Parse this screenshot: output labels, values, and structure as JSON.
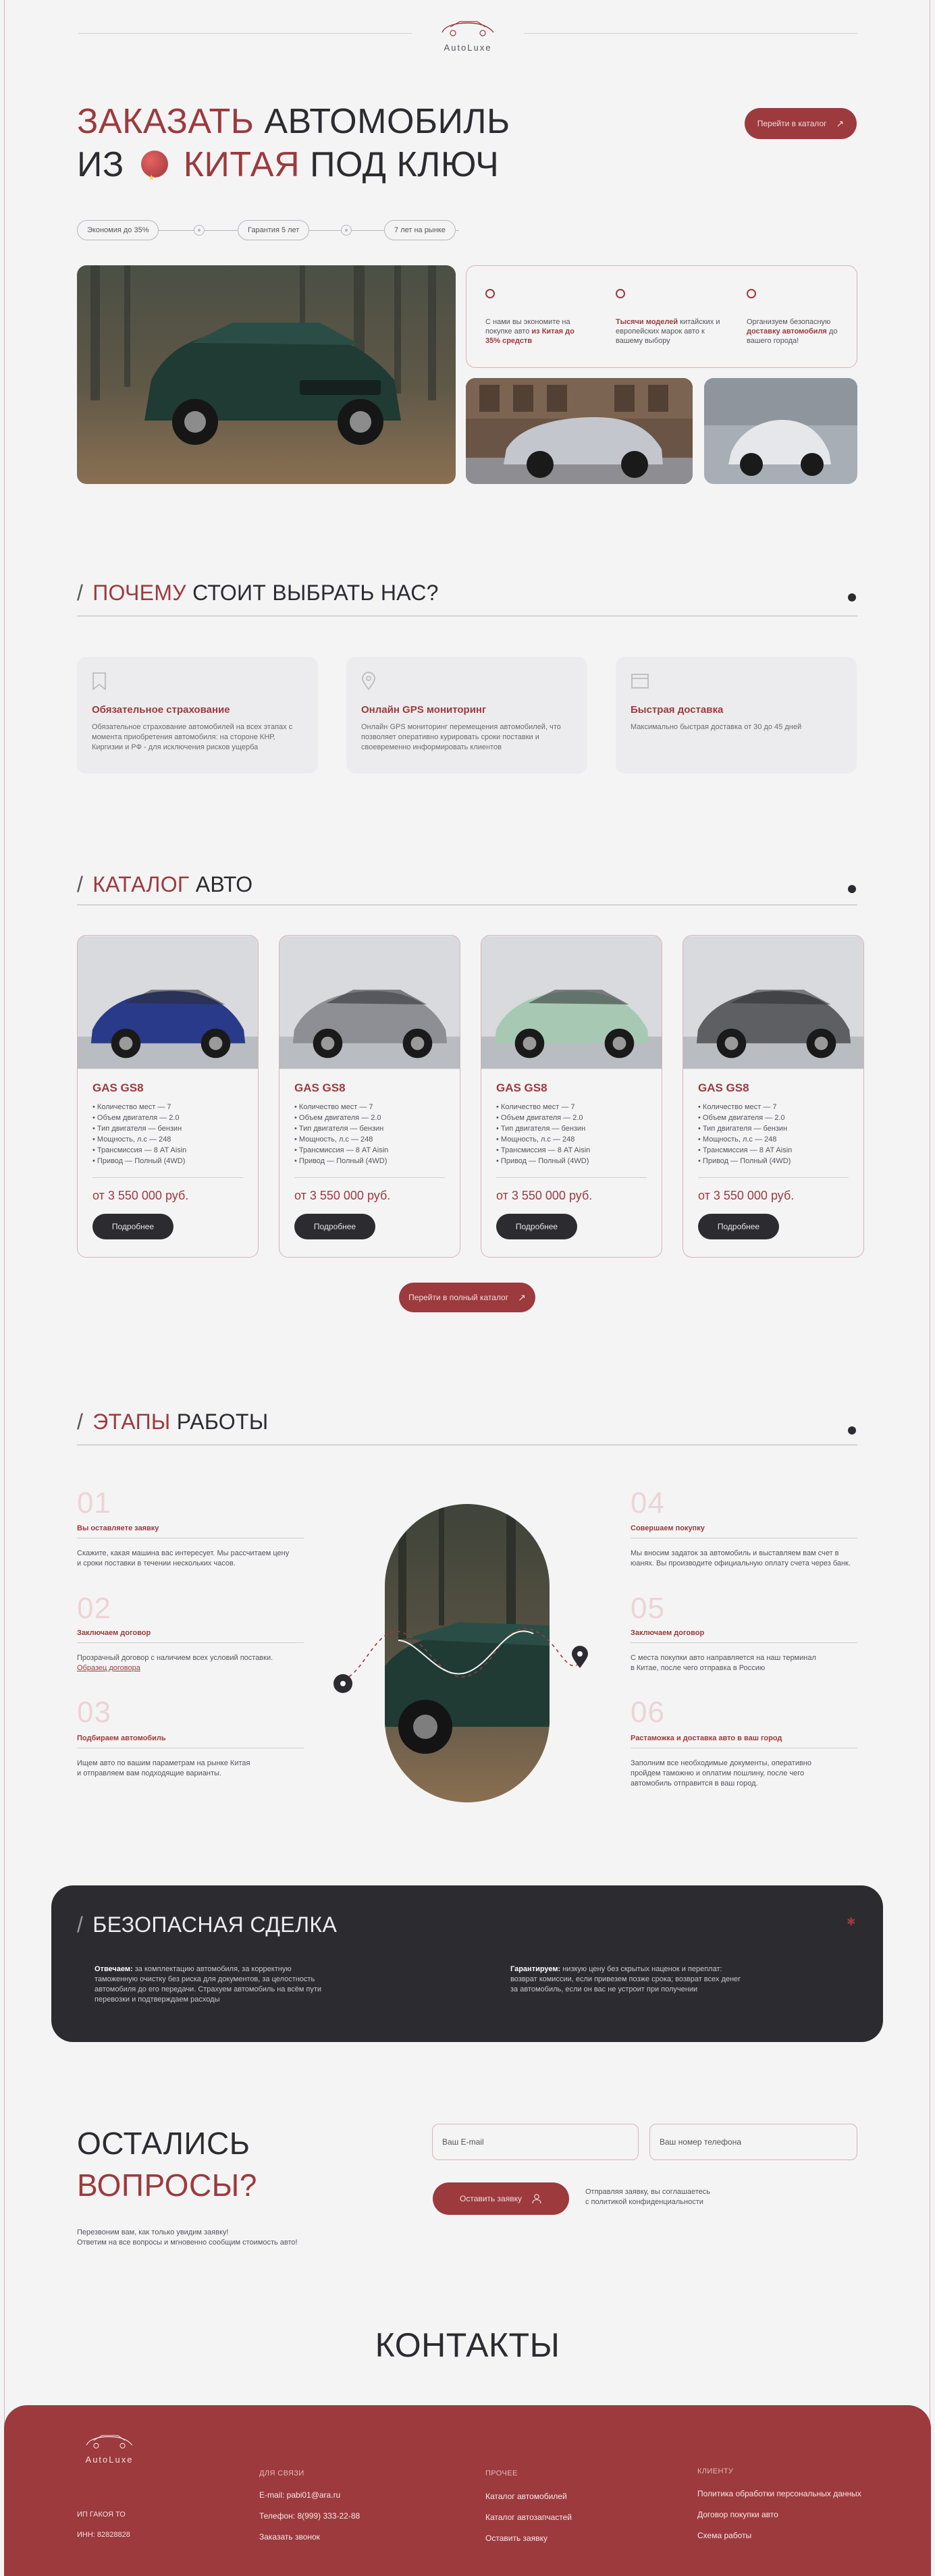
{
  "brand": {
    "name": "AutoLuxe"
  },
  "hero": {
    "title_line1_accent": "ЗАКАЗАТЬ",
    "title_line1_rest": "АВТОМОБИЛЬ",
    "title_line2_prefix": "ИЗ",
    "title_line2_accent": "КИТАЯ",
    "title_line2_rest": "ПОД КЛЮЧ",
    "catalog_button": "Перейти в каталог",
    "chips": [
      "Экономия до 35%",
      "Гарантия 5 лет",
      "7 лет на рынке"
    ],
    "benefits": [
      {
        "text": "С нами вы экономите на покупке авто",
        "bold": "из Китая до 35% средств"
      },
      {
        "bold": "Тысячи моделей",
        "text": "китайских и европейских марок авто к вашему выбору"
      },
      {
        "text": "Организуем безопасную",
        "bold": "доставку автомобиля",
        "text2": "до вашего города!"
      }
    ]
  },
  "why": {
    "title_accent": "ПОЧЕМУ",
    "title_rest": "СТОИТ ВЫБРАТЬ НАС?",
    "features": [
      {
        "icon": "bookmark-icon",
        "title": "Обязательное страхование",
        "text": "Обязательное страхование автомобилей на всех этапах с момента приобретения автомобиля: на стороне КНР, Киргизии и РФ - для исключения рисков ущерба"
      },
      {
        "icon": "map-pin-icon",
        "title": "Онлайн GPS мониторинг",
        "text": "Онлайн GPS мониторинг перемещения автомобилей, что позволяет оперативно курировать сроки поставки и своевременно информировать клиентов"
      },
      {
        "icon": "document-icon",
        "title": "Быстрая доставка",
        "text": "Максимально быстрая доставка от 30 до 45 дней"
      }
    ]
  },
  "catalog": {
    "title_accent": "КАТАЛОГ",
    "title_rest": "АВТО",
    "cars": [
      {
        "model": "GAS GS8",
        "specs": [
          "Количество мест — 7",
          "Объем двигателя — 2.0",
          "Тип двигателя — бензин",
          "Мощность, л.с — 248",
          "Трансмиссия — 8 AT Aisin",
          "Привод — Полный (4WD)"
        ],
        "price": "от 3 550 000 руб.",
        "button": "Подробнее",
        "color": "#2a3a8a"
      },
      {
        "model": "GAS GS8",
        "specs": [
          "Количество мест — 7",
          "Объем двигателя — 2.0",
          "Тип двигателя — бензин",
          "Мощность, л.с — 248",
          "Трансмиссия — 8 AT Aisin",
          "Привод — Полный (4WD)"
        ],
        "price": "от 3 550 000 руб.",
        "button": "Подробнее",
        "color": "#8d8f95"
      },
      {
        "model": "GAS GS8",
        "specs": [
          "Количество мест — 7",
          "Объем двигателя — 2.0",
          "Тип двигателя — бензин",
          "Мощность, л.с — 248",
          "Трансмиссия — 8 AT Aisin",
          "Привод — Полный (4WD)"
        ],
        "price": "от 3 550 000 руб.",
        "button": "Подробнее",
        "color": "#a7c9b4"
      },
      {
        "model": "GAS GS8",
        "specs": [
          "Количество мест — 7",
          "Объем двигателя — 2.0",
          "Тип двигателя — бензин",
          "Мощность, л.с — 248",
          "Трансмиссия — 8 AT Aisin",
          "Привод — Полный (4WD)"
        ],
        "price": "от 3 550 000 руб.",
        "button": "Подробнее",
        "color": "#5d5f63"
      }
    ],
    "full_catalog_button": "Перейти в полный каталог"
  },
  "steps": {
    "title_accent": "ЭТАПЫ",
    "title_rest": "РАБОТЫ",
    "items": [
      {
        "num": "01",
        "title": "Вы оставляете заявку",
        "text1": "Скажите, какая машина вас интересует. Мы рассчитаем цену",
        "text2": "и сроки поставки в течении нескольких часов."
      },
      {
        "num": "02",
        "title": "Заключаем договор",
        "text1": "Прозрачный договор с наличием всех условий поставки.",
        "link": "Образец договора"
      },
      {
        "num": "03",
        "title": "Подбираем автомобиль",
        "text1": "Ищем авто по вашим параметрам на рынке Китая",
        "text2": "и отправляем вам подходящие варианты."
      },
      {
        "num": "04",
        "title": "Совершаем покупку",
        "text1": "Мы вносим задаток за автомобиль и выставляем вам счет в",
        "text2": "юанях. Вы производите официальную оплату счета через банк."
      },
      {
        "num": "05",
        "title": "Заключаем договор",
        "text1": "С места покупки авто направляется на наш терминал",
        "text2": "в Китае, после чего отправка в Россию"
      },
      {
        "num": "06",
        "title": "Растаможка и доставка авто в ваш город",
        "text1": "Заполним все необходимые документы, оперативно",
        "text2": "пройдем таможню и оплатим пошлину, после чего",
        "text3": "автомобиль отправится в ваш город."
      }
    ]
  },
  "deal": {
    "title": "БЕЗОПАСНАЯ СДЕЛКА",
    "left_bold": "Отвечаем:",
    "left_1": "за комплектацию автомобиля, за корректную",
    "left_2": "таможенную очистку без риска для документов, за целостность",
    "left_3": "автомобиля до его передачи. Страхуем автомобиль на всём пути",
    "left_4": "перевозки и подтверждаем расходы",
    "right_bold": "Гарантируем:",
    "right_1": "низкую цену без скрытых наценок и переплат:",
    "right_2": "возврат комиссии, если привезем позже срока; возврат всех денег",
    "right_3": "за автомобиль, если он вас не устроит при получении"
  },
  "questions": {
    "title_line1": "ОСТАЛИСЬ",
    "title_line2": "ВОПРОСЫ?",
    "text1": "Перезвоним вам, как только увидим заявку!",
    "text2": "Ответим на все вопросы и мгновенно сообщим стоимость авто!",
    "email_placeholder": "Ваш E-mail",
    "phone_placeholder": "Ваш номер телефона",
    "submit_button": "Оставить заявку",
    "consent1": "Отправляя заявку, вы соглашаетесь",
    "consent2": "с политикой конфиденциальности"
  },
  "contacts": {
    "title": "КОНТАКТЫ"
  },
  "footer": {
    "company": "ИП ГАКОЯ ТО",
    "inn": "ИНН: 82828828",
    "col1_title": "ДЛЯ СВЯЗИ",
    "email": "E-mail: pabi01@ara.ru",
    "phone": "Телефон: 8(999) 333-22-88",
    "call": "Заказать звонок",
    "col2_title": "ПРОЧЕЕ",
    "links2": [
      "Каталог автомобилей",
      "Каталог автозапчастей",
      "Оставить заявку"
    ],
    "col3_title": "КЛИЕНТУ",
    "links3": [
      "Политика обработки персональных данных",
      "Договор покупки авто",
      "Схема работы"
    ]
  },
  "colors": {
    "accent": "#9c3a3d",
    "dark": "#2c2b30",
    "background": "#f4f4f5"
  }
}
